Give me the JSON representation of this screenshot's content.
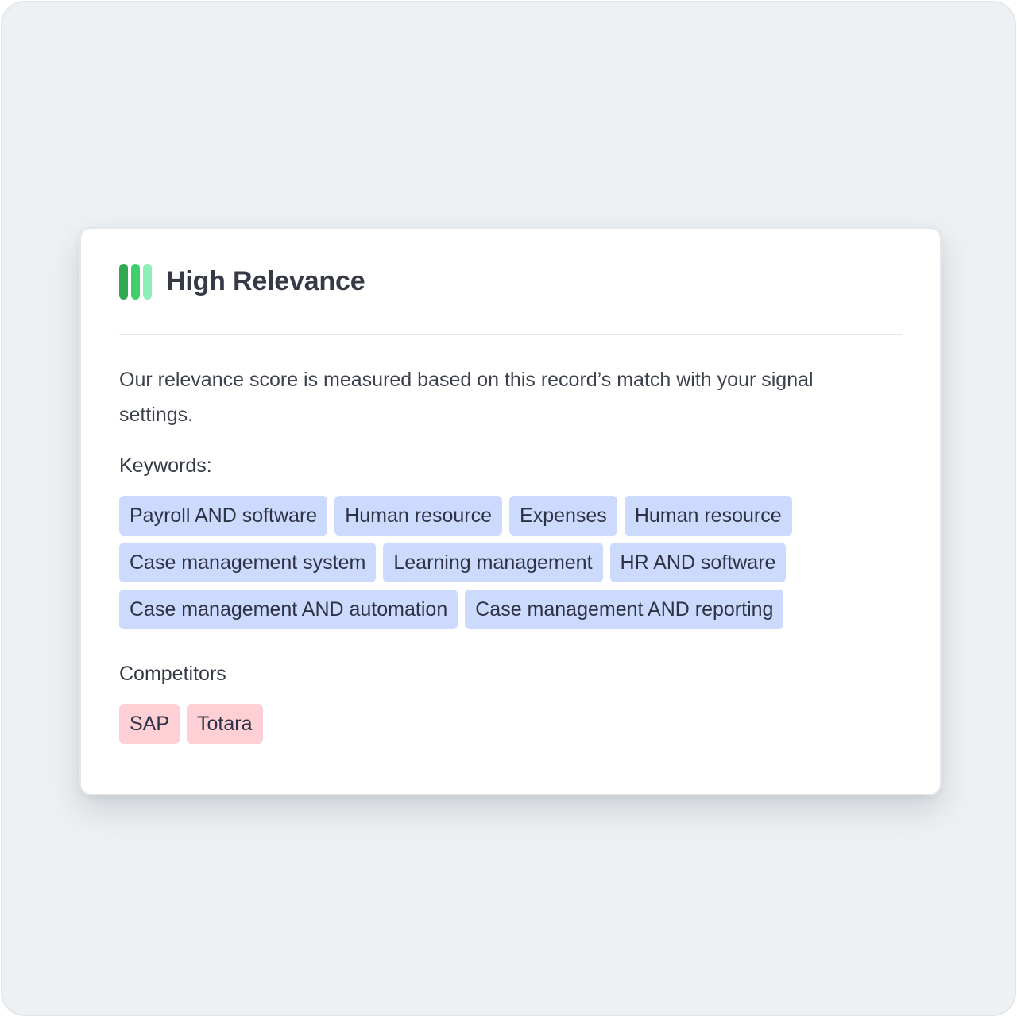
{
  "card": {
    "title": "High Relevance",
    "relevance_level": 3,
    "relevance_max": 3,
    "indicator_colors": [
      "#2fa84f",
      "#3fcf6b",
      "#8ef0b4"
    ],
    "description": "Our relevance score is measured based on this record’s match with your signal settings."
  },
  "keywords": {
    "label": "Keywords:",
    "items": [
      "Payroll AND software",
      "Human resource",
      "Expenses",
      "Human resource",
      "Case management system",
      "Learning management",
      "HR AND software",
      "Case management AND automation",
      "Case management AND reporting"
    ]
  },
  "competitors": {
    "label": "Competitors",
    "items": [
      "SAP",
      "Totara"
    ]
  }
}
